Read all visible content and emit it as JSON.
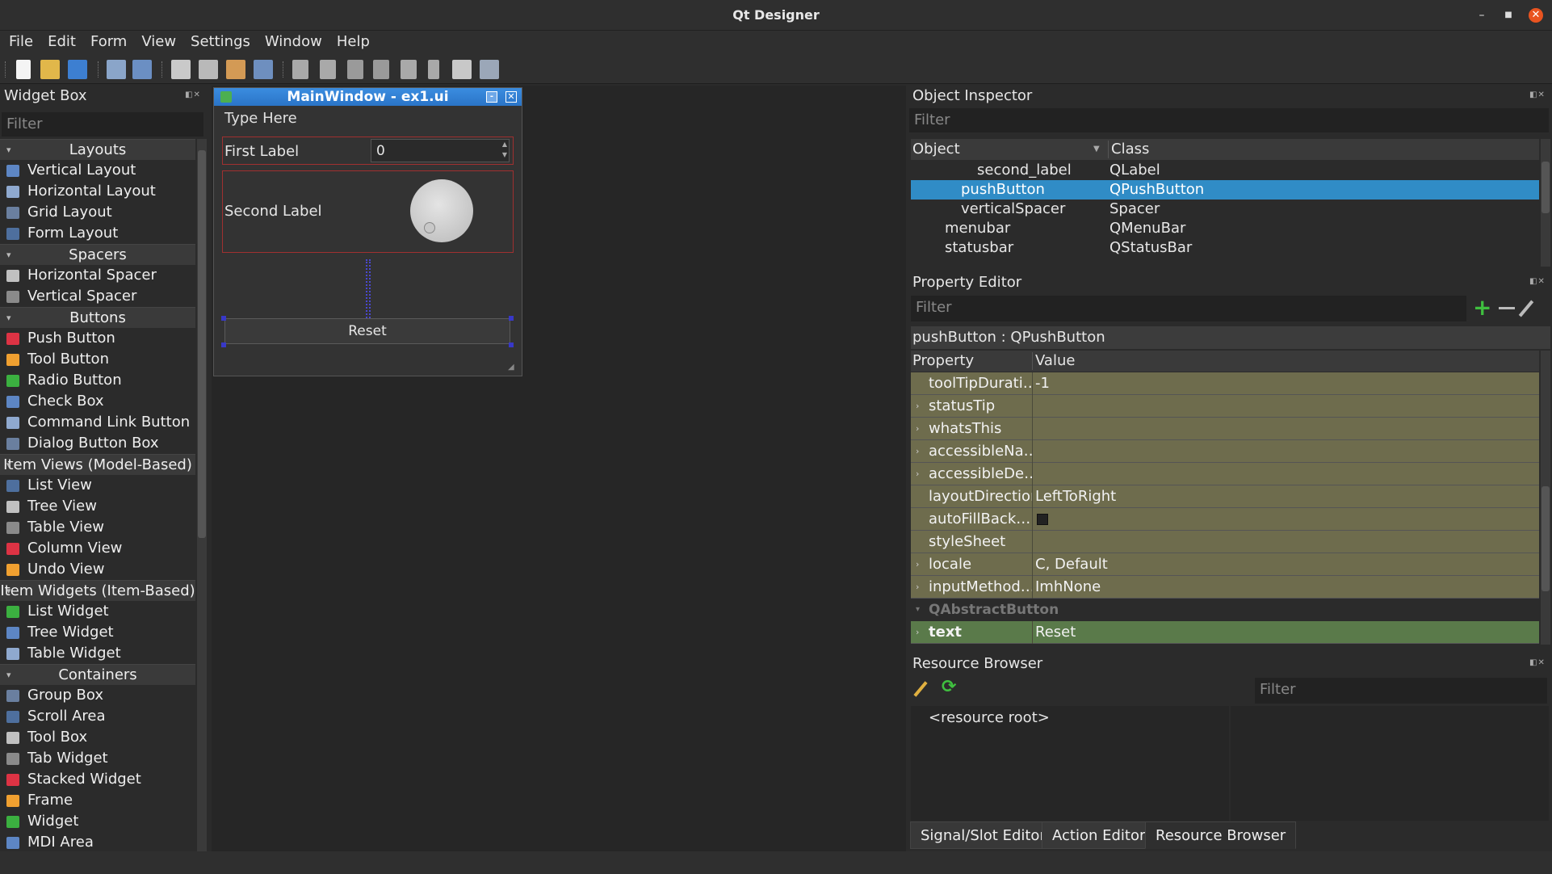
{
  "window": {
    "title": "Qt Designer"
  },
  "menu": [
    "File",
    "Edit",
    "Form",
    "View",
    "Settings",
    "Window",
    "Help"
  ],
  "toolbar_icons": [
    "new-file-icon",
    "open-folder-icon",
    "save-icon",
    "send-to-back-icon",
    "bring-to-front-icon",
    "edit-widgets-icon",
    "edit-signals-slots-icon",
    "edit-buddies-icon",
    "edit-tab-order-icon",
    "lay-out-horizontally-icon",
    "lay-out-vertically-icon",
    "lay-out-horizontal-splitter-icon",
    "lay-out-vertical-splitter-icon",
    "lay-out-grid-icon",
    "lay-out-form-icon",
    "break-layout-icon",
    "adjust-size-icon"
  ],
  "widget_box": {
    "title": "Widget Box",
    "filter_placeholder": "Filter",
    "categories": [
      {
        "name": "Layouts",
        "items": [
          "Vertical Layout",
          "Horizontal Layout",
          "Grid Layout",
          "Form Layout"
        ]
      },
      {
        "name": "Spacers",
        "items": [
          "Horizontal Spacer",
          "Vertical Spacer"
        ]
      },
      {
        "name": "Buttons",
        "items": [
          "Push Button",
          "Tool Button",
          "Radio Button",
          "Check Box",
          "Command Link Button",
          "Dialog Button Box"
        ]
      },
      {
        "name": "Item Views (Model-Based)",
        "items": [
          "List View",
          "Tree View",
          "Table View",
          "Column View",
          "Undo View"
        ]
      },
      {
        "name": "Item Widgets (Item-Based)",
        "items": [
          "List Widget",
          "Tree Widget",
          "Table Widget"
        ]
      },
      {
        "name": "Containers",
        "items": [
          "Group Box",
          "Scroll Area",
          "Tool Box",
          "Tab Widget",
          "Stacked Widget",
          "Frame",
          "Widget",
          "MDI Area"
        ]
      }
    ]
  },
  "form": {
    "title": "MainWindow - ex1.ui",
    "menu_placeholder": "Type Here",
    "first_label": "First Label",
    "spin_value": "0",
    "second_label": "Second Label",
    "button_text": "Reset"
  },
  "object_inspector": {
    "title": "Object Inspector",
    "filter_placeholder": "Filter",
    "col_object": "Object",
    "col_class": "Class",
    "rows": [
      {
        "object": "second_label",
        "class": "QLabel"
      },
      {
        "object": "pushButton",
        "class": "QPushButton"
      },
      {
        "object": "verticalSpacer",
        "class": "Spacer"
      },
      {
        "object": "menubar",
        "class": "QMenuBar"
      },
      {
        "object": "statusbar",
        "class": "QStatusBar"
      }
    ]
  },
  "property_editor": {
    "title": "Property Editor",
    "filter_placeholder": "Filter",
    "header": "pushButton : QPushButton",
    "col_property": "Property",
    "col_value": "Value",
    "rows": [
      {
        "name": "toolTipDurati…",
        "value": "-1"
      },
      {
        "name": "statusTip",
        "value": ""
      },
      {
        "name": "whatsThis",
        "value": ""
      },
      {
        "name": "accessibleNa…",
        "value": ""
      },
      {
        "name": "accessibleDe…",
        "value": ""
      },
      {
        "name": "layoutDirection",
        "value": "LeftToRight"
      },
      {
        "name": "autoFillBack…",
        "value": ""
      },
      {
        "name": "styleSheet",
        "value": ""
      },
      {
        "name": "locale",
        "value": "C, Default"
      },
      {
        "name": "inputMethod…",
        "value": "ImhNone"
      }
    ],
    "section": "QAbstractButton",
    "text_row": {
      "name": "text",
      "value": "Reset"
    }
  },
  "resource_browser": {
    "title": "Resource Browser",
    "filter_placeholder": "Filter",
    "root": "<resource root>"
  },
  "bottom_tabs": [
    "Signal/Slot Editor",
    "Action Editor",
    "Resource Browser"
  ]
}
